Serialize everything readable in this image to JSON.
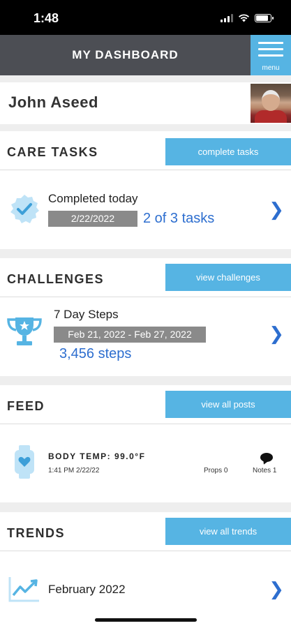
{
  "status_bar": {
    "time": "1:48"
  },
  "header": {
    "title": "MY DASHBOARD",
    "menu_label": "menu"
  },
  "profile": {
    "name": "John Aseed"
  },
  "care_tasks": {
    "title": "CARE TASKS",
    "button": "complete tasks",
    "label": "Completed today",
    "date": "2/22/2022",
    "count": "2 of 3 tasks",
    "progress": {
      "completed": 2,
      "total": 3
    }
  },
  "challenges": {
    "title": "CHALLENGES",
    "button": "view challenges",
    "name": "7 Day Steps",
    "date_range": "Feb 21, 2022 - Feb 27, 2022",
    "steps": "3,456 steps"
  },
  "feed": {
    "title": "FEED",
    "button": "view all posts",
    "post_title": "BODY TEMP: 99.0°F",
    "post_time": "1:41 PM 2/22/22",
    "props": "Props 0",
    "notes": "Notes 1"
  },
  "trends": {
    "title": "TRENDS",
    "button": "view all trends",
    "month": "February 2022"
  },
  "colors": {
    "accent": "#56b4e3",
    "header_bg": "#4c4e54",
    "link_blue": "#2d6ecf",
    "pill_gray": "#8a8a8a",
    "separator": "#eeeeee"
  },
  "icons": [
    "signal-icon",
    "wifi-icon",
    "battery-icon",
    "hamburger-menu-icon",
    "check-badge-icon",
    "trophy-icon",
    "smartwatch-heart-icon",
    "speech-bubble-icon",
    "trend-chart-icon",
    "chevron-right-icon"
  ]
}
